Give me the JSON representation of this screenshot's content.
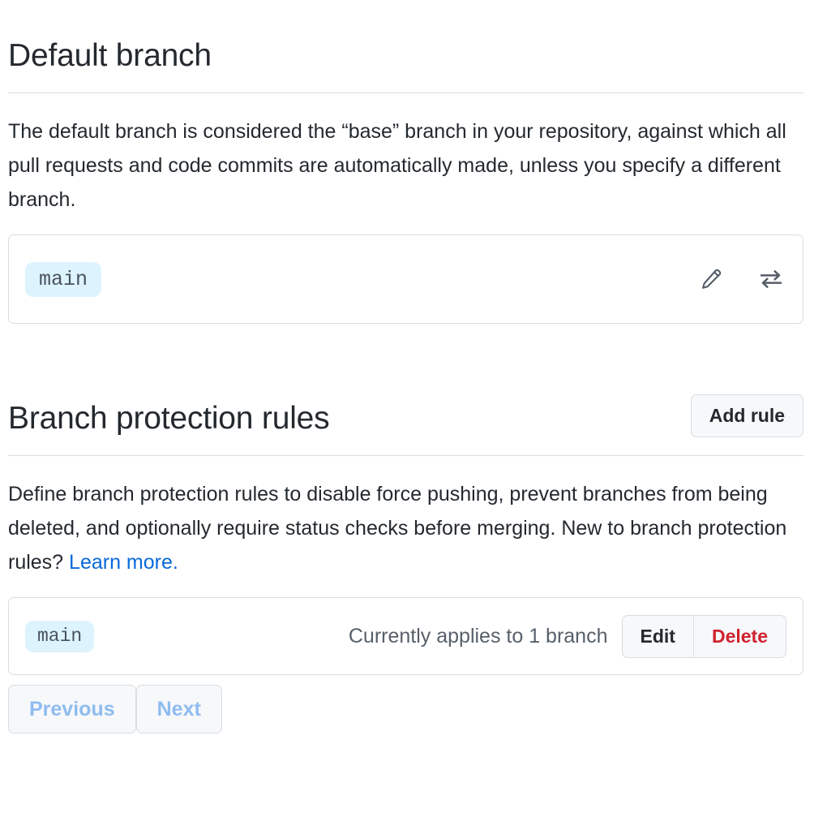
{
  "default_branch": {
    "title": "Default branch",
    "description": "The default branch is considered the “base” branch in your repository, against which all pull requests and code commits are automatically made, unless you specify a different branch.",
    "branch_name": "main",
    "edit_icon": "pencil-icon",
    "switch_icon": "swap-arrows-icon"
  },
  "branch_protection": {
    "title": "Branch protection rules",
    "add_rule_label": "Add rule",
    "description_part1": "Define branch protection rules to disable force pushing, prevent branches from being deleted, and optionally require status checks before merging. New to branch protection rules? ",
    "learn_more_label": "Learn more.",
    "rules": [
      {
        "pattern": "main",
        "applies_to": "Currently applies to 1 branch",
        "edit_label": "Edit",
        "delete_label": "Delete"
      }
    ]
  },
  "pagination": {
    "previous_label": "Previous",
    "next_label": "Next"
  },
  "colors": {
    "link": "#0969da",
    "danger": "#cf222e",
    "badge_bg": "#ddf4ff",
    "border": "#d8dee4",
    "muted_text": "#57606a",
    "disabled_link": "#8fbcf0"
  }
}
